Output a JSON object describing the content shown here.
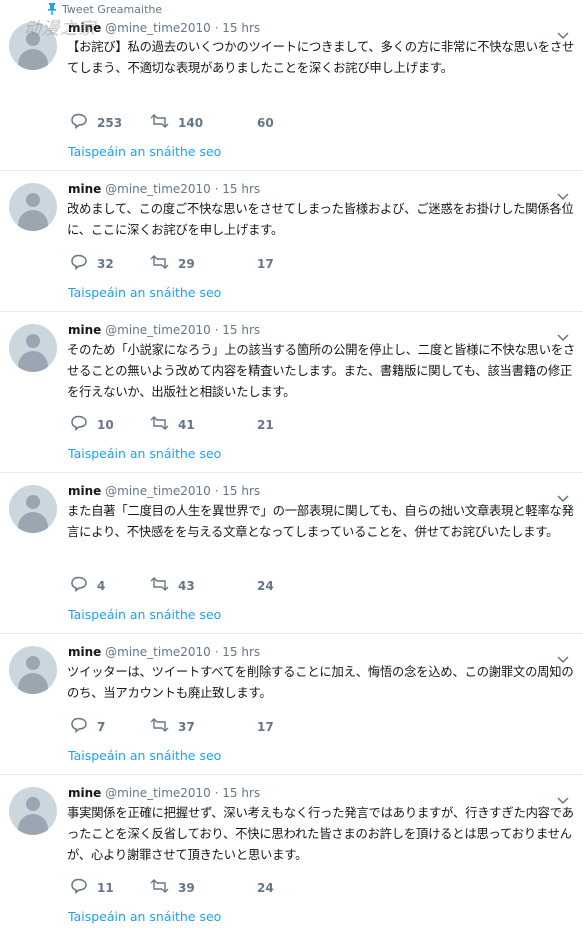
{
  "pinned_label": "Tweet Greamaithe",
  "watermark": "动漫之家",
  "tweets": [
    {
      "name": "mine",
      "handle": "@mine_time2010",
      "dot": "·",
      "time": "15 hrs",
      "text": "【お詫び】私の過去のいくつかのツイートにつきまして、多くの方に非常に不快な思いをさせてしまう、不適切な表現がありましたことを深くお詫び申し上げます。",
      "replies": "253",
      "retweets": "140",
      "likes": "60",
      "thread_link": "Taispeáin an snáithe seo"
    },
    {
      "name": "mine",
      "handle": "@mine_time2010",
      "dot": "·",
      "time": "15 hrs",
      "text": "改めまして、この度ご不快な思いをさせてしまった皆様および、ご迷惑をお掛けした関係各位に、ここに深くお詫びを申し上げます。",
      "replies": "32",
      "retweets": "29",
      "likes": "17",
      "thread_link": "Taispeáin an snáithe seo"
    },
    {
      "name": "mine",
      "handle": "@mine_time2010",
      "dot": "·",
      "time": "15 hrs",
      "text": "そのため「小説家になろう」上の該当する箇所の公開を停止し、二度と皆様に不快な思いをさせることの無いよう改めて内容を精査いたします。また、書籍版に関しても、該当書籍の修正を行えないか、出版社と相談いたします。",
      "replies": "10",
      "retweets": "41",
      "likes": "21",
      "thread_link": "Taispeáin an snáithe seo"
    },
    {
      "name": "mine",
      "handle": "@mine_time2010",
      "dot": "·",
      "time": "15 hrs",
      "text": "また自著「二度目の人生を異世界で」の一部表現に関しても、自らの拙い文章表現と軽率な発言により、不快感をを与える文章となってしまっていることを、併せてお詫びいたします。",
      "replies": "4",
      "retweets": "43",
      "likes": "24",
      "thread_link": "Taispeáin an snáithe seo"
    },
    {
      "name": "mine",
      "handle": "@mine_time2010",
      "dot": "·",
      "time": "15 hrs",
      "text": "ツイッターは、ツイートすべてを削除することに加え、悔悟の念を込め、この謝罪文の周知ののち、当アカウントも廃止致します。",
      "replies": "7",
      "retweets": "37",
      "likes": "17",
      "thread_link": "Taispeáin an snáithe seo"
    },
    {
      "name": "mine",
      "handle": "@mine_time2010",
      "dot": "·",
      "time": "15 hrs",
      "text": "事実関係を正確に把握せず、深い考えもなく行った発言ではありますが、行きすぎた内容であったことを深く反省しており、不快に思われた皆さまのお許しを頂けるとは思っておりませんが、心より謝罪させて頂きたいと思います。",
      "replies": "11",
      "retweets": "39",
      "likes": "24",
      "thread_link": "Taispeáin an snáithe seo"
    }
  ],
  "icons": [
    "pin-icon",
    "reply-icon",
    "retweet-icon",
    "like-icon",
    "caret-down-icon"
  ],
  "colors": {
    "link": "#1da1f2",
    "muted": "#657786",
    "divider": "#e6ecf0",
    "avatar": "#ccd6dd"
  }
}
